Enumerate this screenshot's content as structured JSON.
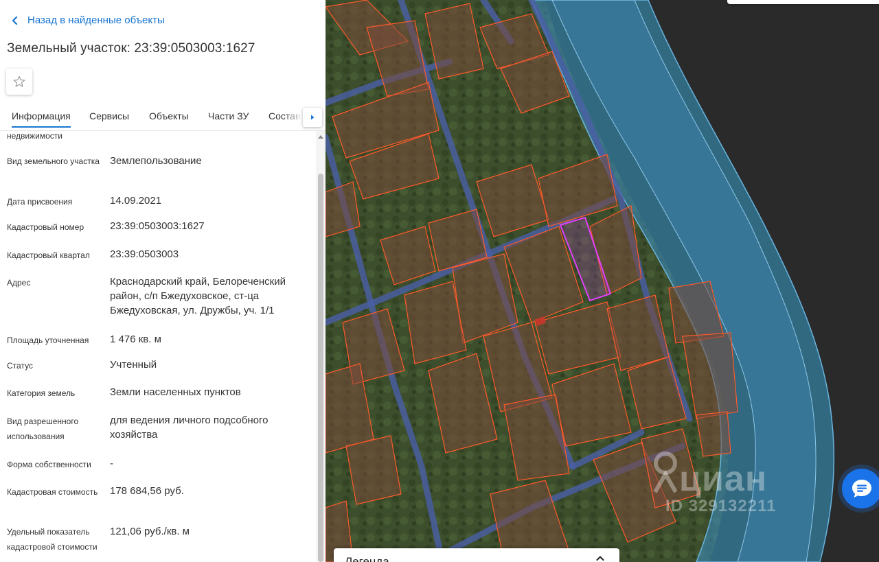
{
  "nav": {
    "back_label": "Назад в найденные объекты"
  },
  "object": {
    "title": "Земельный участок: 23:39:0503003:1627"
  },
  "tabs": [
    {
      "label": "Информация",
      "active": true
    },
    {
      "label": "Сервисы"
    },
    {
      "label": "Объекты"
    },
    {
      "label": "Части ЗУ"
    },
    {
      "label": "Состав"
    }
  ],
  "props": {
    "partial_label": "недвижимости",
    "rows": [
      {
        "label": "Вид земельного участка",
        "value": "Землепользование"
      },
      {
        "label": "Дата присвоения",
        "value": "14.09.2021"
      },
      {
        "label": "Кадастровый номер",
        "value": "23:39:0503003:1627"
      },
      {
        "label": "Кадастровый квартал",
        "value": "23:39:0503003"
      },
      {
        "label": "Адрес",
        "value": "Краснодарский край, Белореченский район, с/п Бжедуховское, ст-ца Бжедуховская, ул. Дружбы, уч. 1/1"
      },
      {
        "label": "Площадь уточненная",
        "value": "1 476 кв. м"
      },
      {
        "label": "Статус",
        "value": "Учтенный"
      },
      {
        "label": "Категория земель",
        "value": "Земли населенных пунктов"
      },
      {
        "label": "Вид разрешенного использования",
        "value": "для ведения личного подсобного хозяйства"
      },
      {
        "label": "Форма собственности",
        "value": "-"
      },
      {
        "label": "Кадастровая стоимость",
        "value": "178 684,56 руб."
      },
      {
        "label": "Удельный показатель кадастровой стоимости",
        "value": "121,06 руб./кв. м"
      }
    ]
  },
  "map": {
    "watermark_brand": "циан",
    "watermark_id": "ID 329132211",
    "legend_title": "Легенда"
  },
  "colors": {
    "accent": "#1976d2",
    "parcel_outline": "#ff5a2a",
    "selected_parcel": "#e040fb",
    "water_zone": "#3a8fc8"
  },
  "icons": {
    "back": "chevron-left-icon",
    "favorite": "star-outline-icon",
    "tabs_more": "caret-right-icon",
    "chat": "chat-bubble-icon",
    "legend_toggle": "chevron-up-icon"
  }
}
